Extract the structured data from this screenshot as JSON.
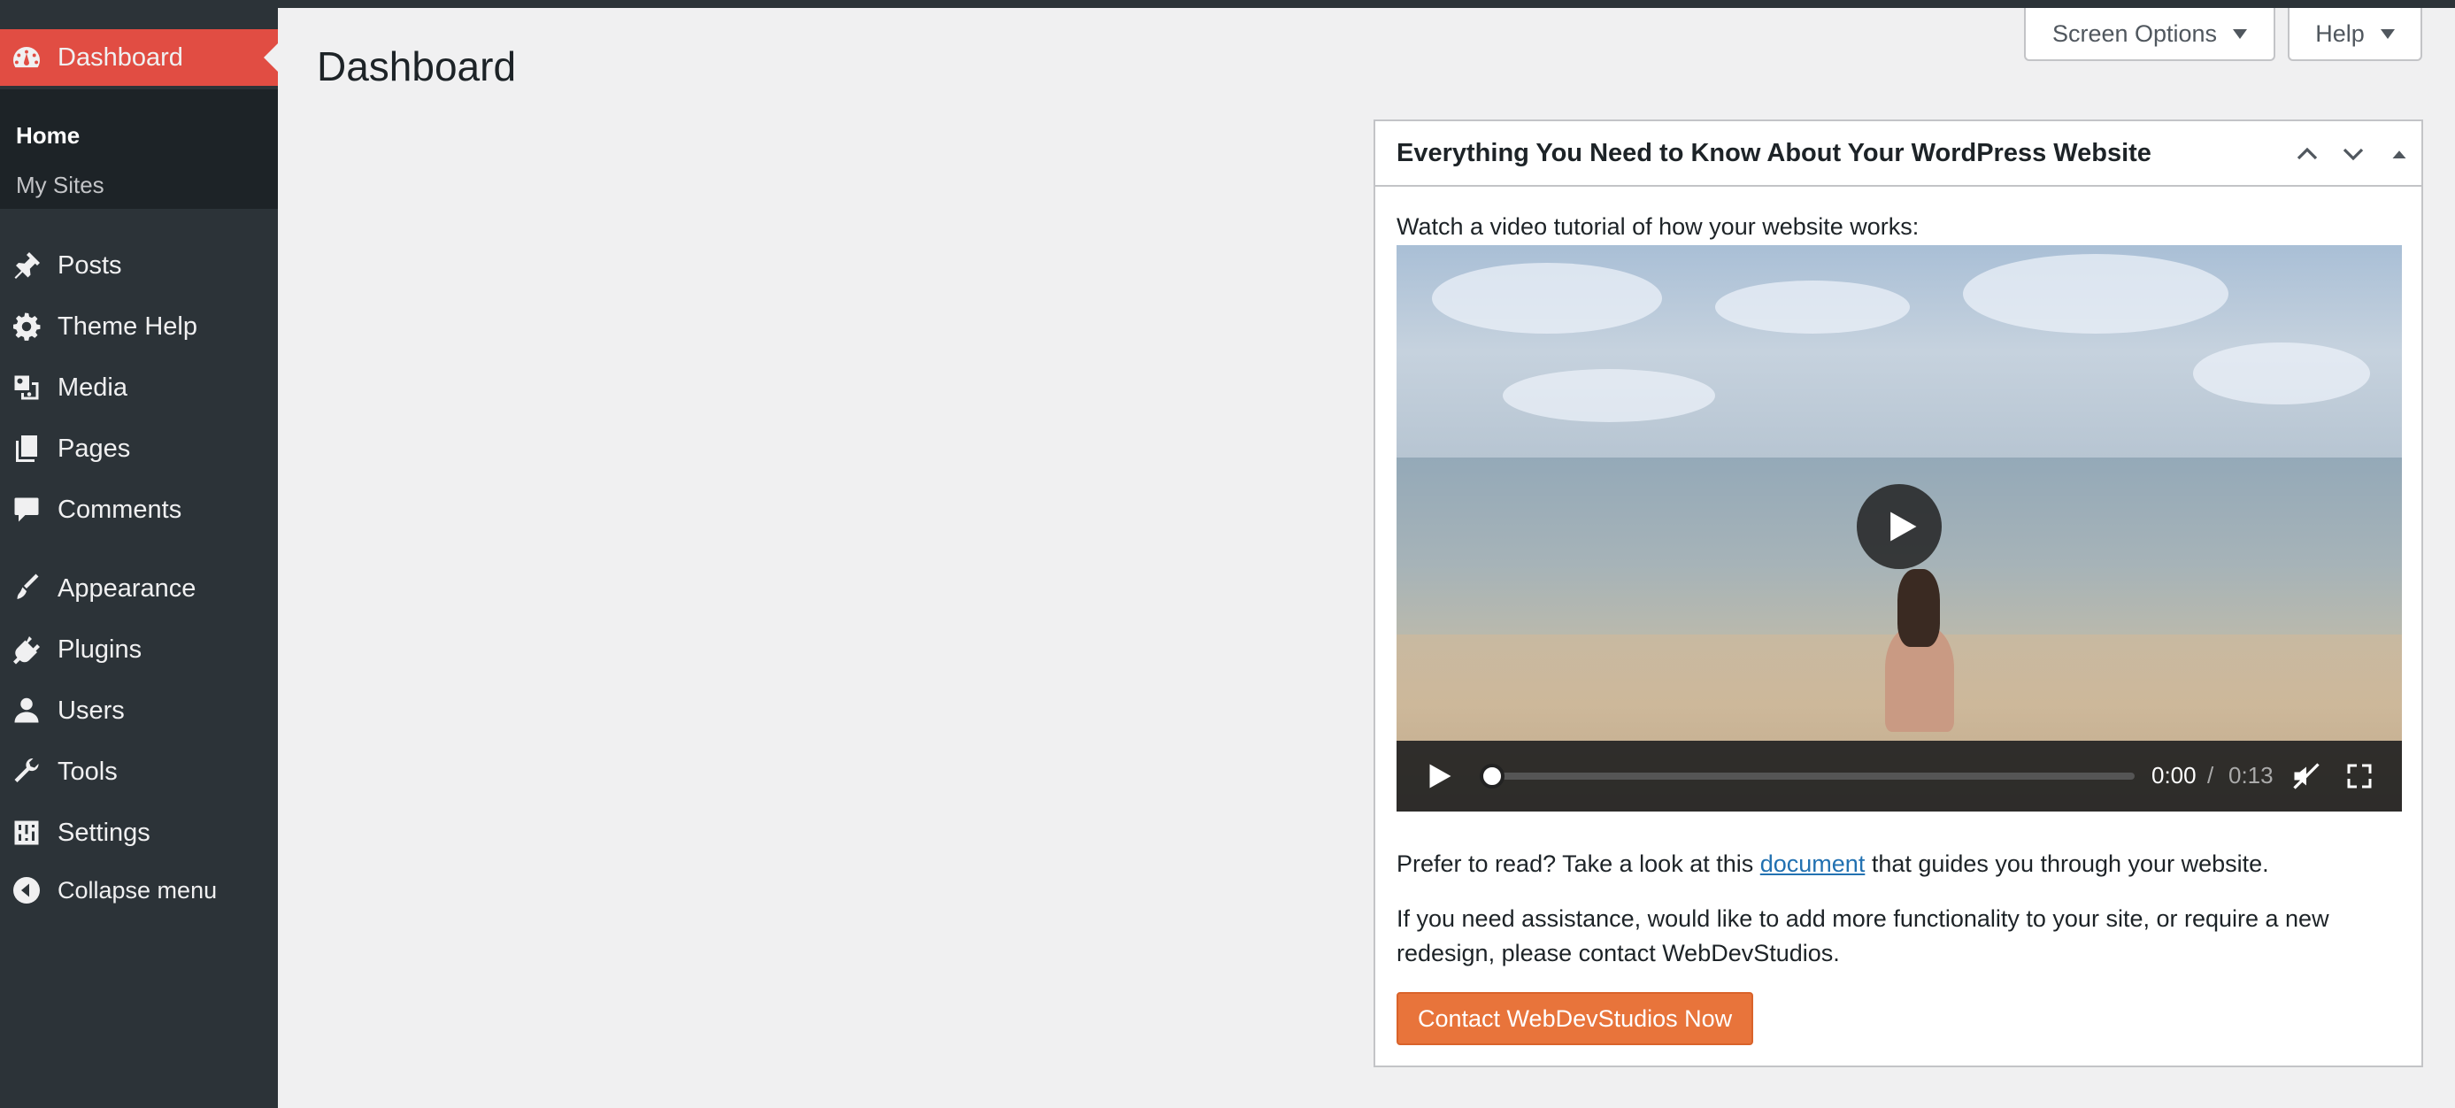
{
  "sidebar": {
    "current": {
      "label": "Dashboard",
      "icon": "dashboard-icon"
    },
    "submenu": [
      {
        "label": "Home",
        "active": true
      },
      {
        "label": "My Sites",
        "active": false
      }
    ],
    "items": [
      {
        "label": "Posts",
        "icon": "pin-icon"
      },
      {
        "label": "Theme Help",
        "icon": "gear-icon"
      },
      {
        "label": "Media",
        "icon": "media-icon"
      },
      {
        "label": "Pages",
        "icon": "pages-icon"
      },
      {
        "label": "Comments",
        "icon": "comment-icon"
      },
      {
        "label": "Appearance",
        "icon": "brush-icon"
      },
      {
        "label": "Plugins",
        "icon": "plug-icon"
      },
      {
        "label": "Users",
        "icon": "user-icon"
      },
      {
        "label": "Tools",
        "icon": "wrench-icon"
      },
      {
        "label": "Settings",
        "icon": "settings-sliders-icon"
      }
    ],
    "collapse_label": "Collapse menu"
  },
  "header": {
    "page_title": "Dashboard",
    "screen_options_label": "Screen Options",
    "help_label": "Help"
  },
  "widget": {
    "title": "Everything You Need to Know About Your WordPress Website",
    "intro": "Watch a video tutorial of how your website works:",
    "video": {
      "current_time": "0:00",
      "separator": "/",
      "duration": "0:13",
      "progress": 0
    },
    "read_prefix": "Prefer to read? Take a look at this ",
    "read_link": "document",
    "read_suffix": " that guides you through your website.",
    "assistance": "If you need assistance, would like to add more functionality to your site, or require a new redesign, please contact WebDevStudios.",
    "contact_button": "Contact WebDevStudios Now"
  },
  "colors": {
    "sidebar_bg": "#2c3338",
    "current_item": "#e14d43",
    "button_orange": "#e8743b",
    "link": "#2271b1"
  }
}
